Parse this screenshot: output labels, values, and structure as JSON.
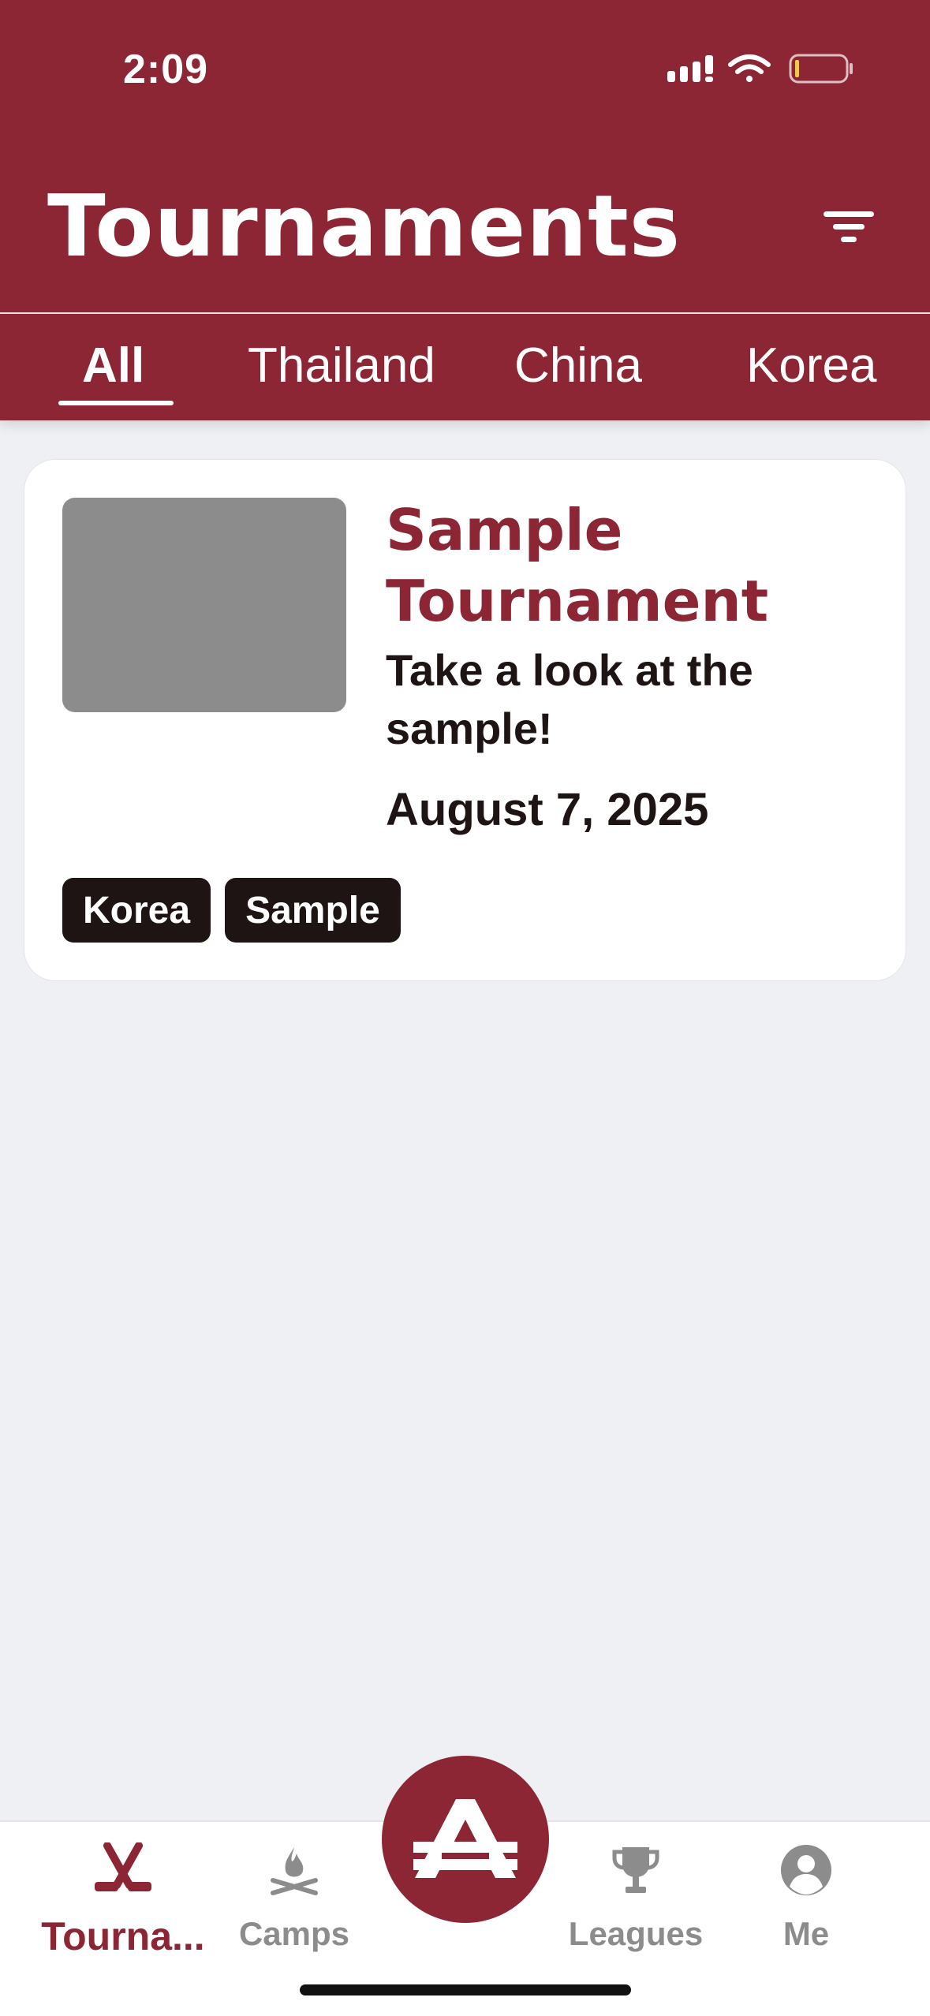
{
  "status_bar": {
    "time": "2:09"
  },
  "header": {
    "title": "Tournaments"
  },
  "tabs": [
    {
      "label": "All",
      "active": true
    },
    {
      "label": "Thailand",
      "active": false
    },
    {
      "label": "China",
      "active": false
    },
    {
      "label": "Korea",
      "active": false
    }
  ],
  "card": {
    "title": "Sample Tournament",
    "subtitle": "Take a look at the sample!",
    "date": "August 7, 2025",
    "tags": [
      "Korea",
      "Sample"
    ]
  },
  "bottom_nav": [
    {
      "label": "Tourna...",
      "icon": "hockey-sticks-icon",
      "active": true
    },
    {
      "label": "Camps",
      "icon": "campfire-icon",
      "active": false
    },
    {
      "label": "Leagues",
      "icon": "trophy-icon",
      "active": false
    },
    {
      "label": "Me",
      "icon": "person-icon",
      "active": false
    }
  ],
  "colors": {
    "brand": "#8C2634",
    "background": "#EFF0F4",
    "tag": "#1E1414",
    "inactive": "#8C8C8C"
  }
}
